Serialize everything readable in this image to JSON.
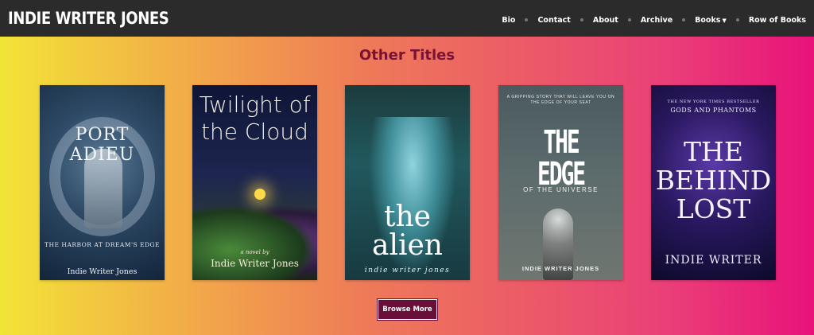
{
  "brand": {
    "name": "INDIE WRITER JONES"
  },
  "nav": {
    "items": [
      {
        "label": "Bio"
      },
      {
        "label": "Contact"
      },
      {
        "label": "About"
      },
      {
        "label": "Archive"
      },
      {
        "label": "Books",
        "has_dropdown": true
      },
      {
        "label": "Row of Books"
      }
    ]
  },
  "section": {
    "title": "Other Titles"
  },
  "covers": [
    {
      "title": "PORT ADIEU",
      "subtitle": "THE HARBOR AT DREAM'S EDGE",
      "author": "Indie Writer Jones"
    },
    {
      "title": "Twilight of the Cloud",
      "subtitle": "a novel by",
      "author": "Indie Writer Jones"
    },
    {
      "title": "the alien",
      "author": "indie writer jones"
    },
    {
      "title": "THE EDGE",
      "tagline": "A GRIPPING STORY THAT WILL LEAVE YOU ON THE EDGE OF YOUR SEAT",
      "subtitle": "OF THE UNIVERSE",
      "author": "INDIE WRITER JONES"
    },
    {
      "title": "THE BEHIND LOST",
      "tagline": "THE NEW YORK TIMES BESTSELLER",
      "subtitle": "GODS AND PHANTOMS",
      "author": "INDIE WRITER"
    }
  ],
  "browse_button": {
    "label": "Browse More"
  },
  "colors": {
    "topbar": "#2b2b2b",
    "section_title": "#7a1236",
    "button_bg": "#6a0f3a",
    "gradient_start": "#f2e437",
    "gradient_end": "#e8127a"
  }
}
